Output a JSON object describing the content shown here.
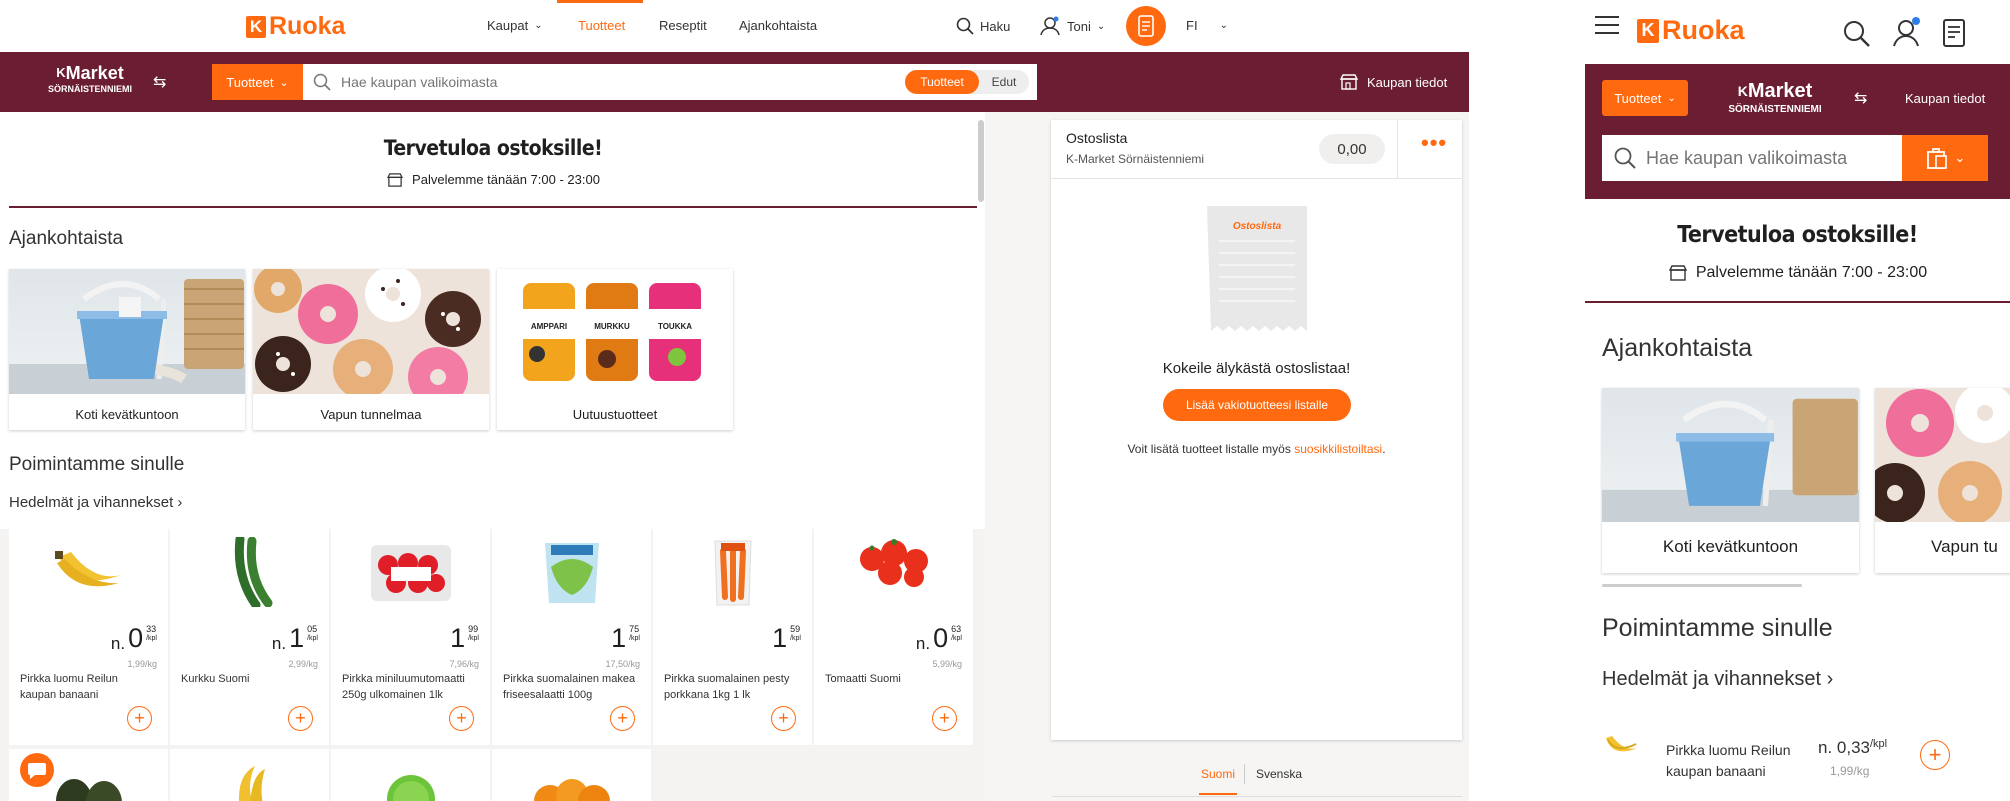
{
  "brand": {
    "k": "K",
    "name": "Ruoka",
    "accent": "#ff6a10",
    "maroon": "#6b1e32"
  },
  "topnav": {
    "items": [
      "Kaupat",
      "Tuotteet",
      "Reseptit",
      "Ajankohtaista"
    ],
    "search_label": "Haku",
    "user_label": "Toni",
    "lang": "FI"
  },
  "store": {
    "line1": "K",
    "line1b": "Market",
    "line2": "SÖRNÄISTENNIEMI",
    "info_label": "Kaupan tiedot"
  },
  "search": {
    "dropdown_label": "Tuotteet",
    "placeholder": "Hae kaupan valikoimasta",
    "toggle_products": "Tuotteet",
    "toggle_deals": "Edut"
  },
  "welcome": {
    "title": "Tervetuloa ostoksille!",
    "hours": "Palvelemme tänään 7:00 - 23:00"
  },
  "current": {
    "title": "Ajankohtaista",
    "cards": [
      "Koti kevätkuntoon",
      "Vapun tunnelmaa",
      "Uutuustuotteet"
    ],
    "can_labels": [
      "AMPPARI",
      "MURKKU",
      "TOUKKA"
    ]
  },
  "picks": {
    "title": "Poimintamme sinulle",
    "category": "Hedelmät ja vihannekset ›",
    "products": [
      {
        "prefix": "n.",
        "euros": "0",
        "cents": "33",
        "unit": "/kpl",
        "per": "1,99/kg",
        "name": "Pirkka luomu Reilun kaupan banaani"
      },
      {
        "prefix": "n.",
        "euros": "1",
        "cents": "05",
        "unit": "/kpl",
        "per": "2,99/kg",
        "name": "Kurkku Suomi"
      },
      {
        "prefix": "",
        "euros": "1",
        "cents": "99",
        "unit": "/kpl",
        "per": "7,96/kg",
        "name": "Pirkka miniluumutomaatti 250g ulkomainen 1lk"
      },
      {
        "prefix": "",
        "euros": "1",
        "cents": "75",
        "unit": "/kpl",
        "per": "17,50/kg",
        "name": "Pirkka suomalainen makea friseesalaatti 100g"
      },
      {
        "prefix": "",
        "euros": "1",
        "cents": "59",
        "unit": "/kpl",
        "per": "",
        "name": "Pirkka suomalainen pesty porkkana 1kg 1 lk"
      },
      {
        "prefix": "n.",
        "euros": "0",
        "cents": "63",
        "unit": "/kpl",
        "per": "5,99/kg",
        "name": "Tomaatti Suomi"
      }
    ],
    "add_symbol": "+"
  },
  "list": {
    "title": "Ostoslista",
    "store": "K-Market Sörnäistenniemi",
    "total": "0,00",
    "paper_label": "Ostoslista",
    "cta_text": "Kokeile älykästä ostoslistaa!",
    "cta_button": "Lisää vakiotuotteesi listalle",
    "hint_prefix": "Voit lisätä tuotteet listalle myös ",
    "hint_link": "suosikkilistoiltasi",
    "hint_suffix": "."
  },
  "language_tabs": [
    "Suomi",
    "Svenska"
  ],
  "mobile": {
    "dropdown_label": "Tuotteet",
    "store_line1": "K",
    "store_line1b": "Market",
    "store_line2": "SÖRNÄISTENNIEMI",
    "info_label": "Kaupan tiedot",
    "placeholder": "Hae kaupan valikoimasta",
    "welcome_title": "Tervetuloa ostoksille!",
    "hours": "Palvelemme tänään 7:00 - 23:00",
    "current_title": "Ajankohtaista",
    "cards": [
      "Koti kevätkuntoon",
      "Vapun tu"
    ],
    "picks_title": "Poimintamme sinulle",
    "category": "Hedelmät ja vihannekset ›",
    "item_name": "Pirkka luomu Reilun kaupan banaani",
    "item_price": "n. 0,33",
    "item_unit": "/kpl",
    "item_per": "1,99/kg"
  }
}
